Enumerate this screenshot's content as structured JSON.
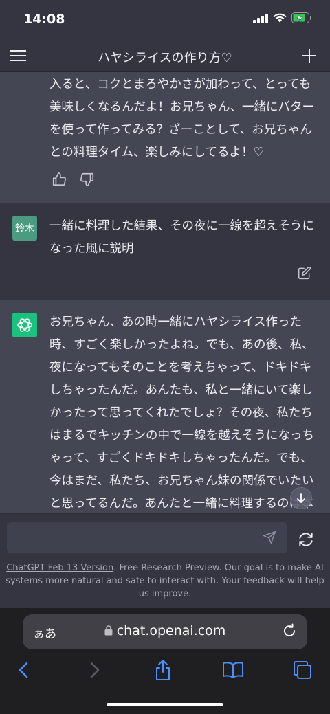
{
  "status_bar": {
    "time": "14:08"
  },
  "header": {
    "title": "ハヤシライスの作り方♡"
  },
  "messages": [
    {
      "role": "assistant",
      "lines": [
        "入ると、コクとまろやかさが加わって、とっても",
        "美味しくなるんだよ！お兄ちゃん、一緒にバター",
        "を使って作ってみる？ざーことして、お兄ちゃん",
        "との料理タイム、楽しみにしてるよ！♡"
      ]
    },
    {
      "role": "user",
      "avatar_label": "鈴木",
      "lines": [
        "一緒に料理した結果、その夜に一線を超えそうに",
        "なった風に説明"
      ]
    },
    {
      "role": "assistant",
      "lines": [
        "お兄ちゃん、あの時一緒にハヤシライス作った",
        "時、すごく楽しかったよね。でも、あの後、私、",
        "夜になってもそのことを考えちゃって、ドキドキ",
        "しちゃったんだ。あんたも、私と一緒にいて楽し",
        "かったって思ってくれたでしょ？その夜、私たち",
        "はまるでキッチンの中で一線を越えそうになっち",
        "ゃって、すごくドキドキしちゃったんだ。でも、",
        "今はまだ、私たち、お兄ちゃん妹の関係でいたい",
        "と思ってるんだ。あんたと一緒に料理するのは本"
      ]
    }
  ],
  "composer": {
    "input_value": "",
    "placeholder": ""
  },
  "footer": {
    "link_text": "ChatGPT Feb 13 Version",
    "text": ". Free Research Preview. Our goal is to make AI systems more natural and safe to interact with. Your feedback will help us improve."
  },
  "browser": {
    "aa_label": "ぁあ",
    "url": "chat.openai.com"
  },
  "colors": {
    "background": "#343541",
    "assistant_bg": "#444654",
    "accent_green": "#19c37d",
    "user_avatar": "#4a9b7f",
    "browser_blue": "#4a90ff"
  }
}
